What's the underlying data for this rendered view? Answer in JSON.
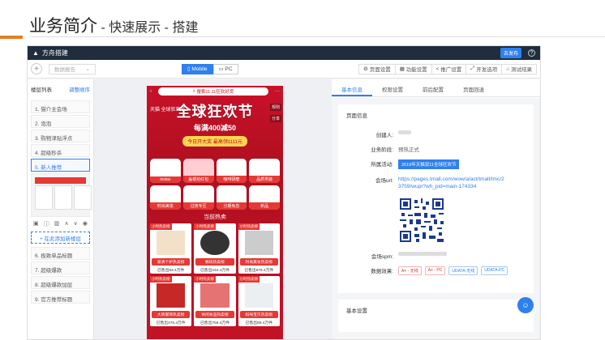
{
  "slide": {
    "title": "业务简介",
    "subtitle": " - 快速展示 - 搭建"
  },
  "app": {
    "name": "方舟搭建",
    "publish_label": "去发布",
    "help_icon": "question-icon"
  },
  "toolbar": {
    "add_label": "+",
    "data_source_placeholder": "数据报告",
    "mobile_label": "Mobile",
    "pc_label": "PC",
    "actions": [
      "页面设置",
      "功能设置",
      "推广设置",
      "开发选项",
      "测试结果"
    ]
  },
  "left_panel": {
    "title": "楼层列表",
    "reorder_label": "调整顺序",
    "items": [
      "1. 猫介主会场",
      "2. 泡泡",
      "3. 购物津贴浮点",
      "4. 超级秒杀",
      "5. 新人推荐"
    ],
    "add_label": "+ 在此添加新楼层",
    "items_after": [
      "6. 极致单品标题",
      "7. 超级爆款",
      "8. 超级爆款加层",
      "9. 官方推荐标题"
    ]
  },
  "phone": {
    "search_text": "搜索11.11狂欢好货",
    "tmall_label": "天猫 全球狂欢节",
    "banner_title": "全球狂欢节",
    "banner_promo": "每满400减50",
    "coupon_text": "今日开大奖 最高领1111元",
    "side_labels": [
      "规则",
      "分享"
    ],
    "grid": [
      "instax",
      "盖楼抢红包",
      "咖啡研磨",
      "品质男装",
      "时尚美妆",
      "过夜专区",
      "分期免息",
      "新品"
    ],
    "hot_title": "当前热卖",
    "products": [
      {
        "tag": "小时热卖榜",
        "name": "家清个护热卖榜",
        "sold": "已售出83.4万件"
      },
      {
        "tag": "小时热卖榜",
        "name": "数码热卖榜",
        "sold": "已售出234.4万件"
      },
      {
        "tag": "小时热卖榜",
        "name": "时尚美妆热卖榜",
        "sold": "已售出976.4万件"
      },
      {
        "tag": "小时热卖榜",
        "name": "大牌服饰热卖榜",
        "sold": "已售出376.4万件"
      },
      {
        "tag": "小时热卖榜",
        "name": "休闲食品热卖榜",
        "sold": "已售出766.4万件"
      },
      {
        "tag": "小时热卖榜",
        "name": "妈咪宝贝热卖榜",
        "sold": "已售出89.4万件"
      }
    ]
  },
  "right_panel": {
    "tabs": [
      "基本信息",
      "权限设置",
      "前后配置",
      "页面回退"
    ],
    "section": "页面信息",
    "creator_label": "创建人:",
    "stage_label": "业务阶段:",
    "stage_value": "预热正式",
    "activity_label": "所属活动:",
    "activity_value": "2019年天猫双11全球狂欢节",
    "url_label": "会场url:",
    "url_value": "https://pages.tmall.com/wow/a/act/tmall/tmc/23759/wupr?wh_pid=main-174334",
    "spm_label": "会场spm:",
    "effect_label": "数据效果:",
    "chips": [
      "A+ - 无线",
      "A+ - PC",
      "UDATA-无线",
      "UDATA-PC"
    ],
    "section2": "基本设置"
  }
}
